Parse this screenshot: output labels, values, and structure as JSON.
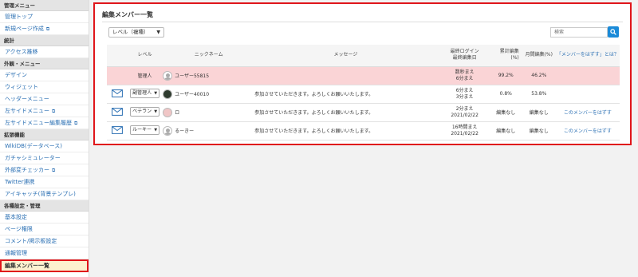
{
  "sidebar": {
    "sections": [
      {
        "heading": "管理メニュー",
        "items": [
          {
            "label": "管理トップ",
            "ext": false
          },
          {
            "label": "新規ページ作成",
            "ext": true
          }
        ]
      },
      {
        "heading": "統計",
        "items": [
          {
            "label": "アクセス推移",
            "ext": false
          }
        ]
      },
      {
        "heading": "外観・メニュー",
        "items": [
          {
            "label": "デザイン",
            "ext": false
          },
          {
            "label": "ウィジェット",
            "ext": false
          },
          {
            "label": "ヘッダーメニュー",
            "ext": false
          },
          {
            "label": "左サイドメニュー",
            "ext": true
          },
          {
            "label": "左サイドメニュー編集履歴",
            "ext": true
          }
        ]
      },
      {
        "heading": "拡張機能",
        "items": [
          {
            "label": "WikiDB(データベース)",
            "ext": false
          },
          {
            "label": "ガチャシミュレーター",
            "ext": false
          },
          {
            "label": "外部変チェッカー",
            "ext": true
          },
          {
            "label": "Twitter連携",
            "ext": false
          },
          {
            "label": "アイキャッチ(背景テンプレ)",
            "ext": false
          }
        ]
      },
      {
        "heading": "各種設定・管理",
        "items": [
          {
            "label": "基本設定",
            "ext": false
          },
          {
            "label": "ページ権限",
            "ext": false
          },
          {
            "label": "コメント/掲示板設定",
            "ext": false
          },
          {
            "label": "通報管理",
            "ext": false
          },
          {
            "label": "編集メンバー一覧",
            "ext": false,
            "active": true
          }
        ]
      }
    ]
  },
  "main": {
    "title": "編集メンバー一覧",
    "level_filter": "レベル（複種）",
    "search_placeholder": "検索",
    "columns": {
      "level": "レベル",
      "nickname": "ニックネーム",
      "message": "メッセージ",
      "login_line1": "最終ログイン",
      "login_line2": "最終編集日",
      "total": "累計編集(%)",
      "month": "月間編集(%)",
      "link": "「メンバーをはずす」とは？"
    },
    "rows": [
      {
        "level": "管理人",
        "nickname": "ユーザー55815",
        "avatar": "user",
        "message": "",
        "login": "数秒まえ",
        "edited": "6分まえ",
        "total": "99.2%",
        "month": "46.2%",
        "link": "",
        "admin": true
      },
      {
        "level": "副管理人",
        "nickname": "ユーザー40010",
        "avatar": "cat",
        "message": "参加させていただきます。よろしくお願いいたします。",
        "login": "6分まえ",
        "edited": "3分まえ",
        "total": "0.8%",
        "month": "53.8%",
        "link": ""
      },
      {
        "level": "ベテラン",
        "nickname": "ロ",
        "avatar": "pig",
        "message": "参加させていただきます。よろしくお願いいたします。",
        "login": "2分まえ",
        "edited": "2021/02/22",
        "total": "編集なし",
        "month": "編集なし",
        "link": "このメンバーをはずす"
      },
      {
        "level": "ルーキー",
        "nickname": "るーきー",
        "avatar": "user",
        "message": "参加させていただきます。よろしくお願いいたします。",
        "login": "16時間まえ",
        "edited": "2021/02/22",
        "total": "編集なし",
        "month": "編集なし",
        "link": "このメンバーをはずす"
      }
    ]
  }
}
